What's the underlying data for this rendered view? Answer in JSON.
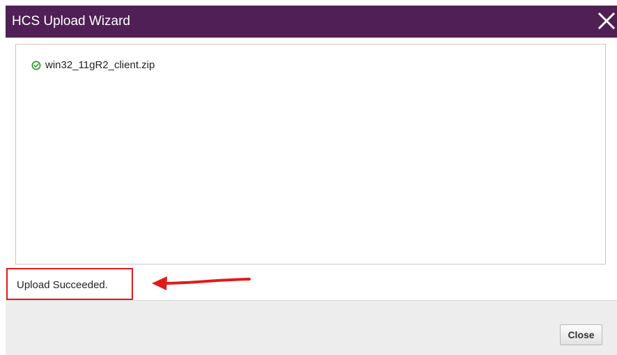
{
  "dialog": {
    "title": "HCS Upload Wizard",
    "title_bar_color": "#4f1f55",
    "close_icon": "close-icon"
  },
  "files": [
    {
      "name": "win32_11gR2_client.zip",
      "status_icon": "check-circle-icon",
      "status_color": "#2e9e2e"
    }
  ],
  "status": {
    "text": "Upload Succeeded.",
    "highlight_color": "#e11b1b",
    "annotation_icon": "red-arrow-icon"
  },
  "footer": {
    "close_label": "Close"
  }
}
